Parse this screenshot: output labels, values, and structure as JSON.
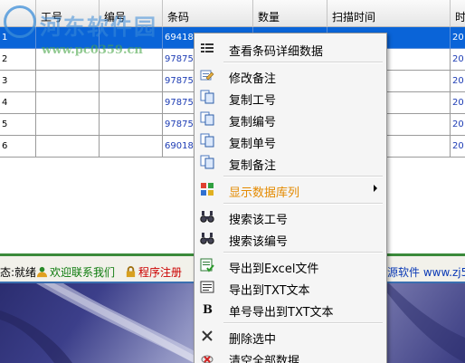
{
  "grid": {
    "columns": [
      "",
      "工号",
      "编号",
      "条码",
      "数量",
      "扫描时间",
      "时"
    ],
    "rows": [
      {
        "index": "1",
        "barcode": "694182",
        "time": "20"
      },
      {
        "index": "2",
        "barcode": "978755",
        "time": "20"
      },
      {
        "index": "3",
        "barcode": "978756",
        "time": "20"
      },
      {
        "index": "4",
        "barcode": "978750",
        "time": "20"
      },
      {
        "index": "5",
        "barcode": "978754",
        "time": "20"
      },
      {
        "index": "6",
        "barcode": "690182",
        "time": "20"
      }
    ],
    "selected_row": 0
  },
  "status": {
    "state": "态:就绪",
    "contact": "欢迎联系我们",
    "register": "程序注册",
    "vendor": "源软件 www.zj5"
  },
  "watermark": {
    "title": "河东软件园",
    "url": "www.pc0359.cn"
  },
  "menu": {
    "items": [
      {
        "label": "查看条码详细数据",
        "icon": "grid-details-icon"
      },
      {
        "label": "修改备注",
        "icon": "edit-note-icon"
      },
      {
        "label": "复制工号",
        "icon": "copy-icon"
      },
      {
        "label": "复制编号",
        "icon": "copy-icon"
      },
      {
        "label": "复制单号",
        "icon": "copy-icon"
      },
      {
        "label": "复制备注",
        "icon": "copy-icon"
      },
      {
        "label": "显示数据库列",
        "icon": "database-columns-icon",
        "submenu": true
      },
      {
        "label": "搜索该工号",
        "icon": "binoculars-icon"
      },
      {
        "label": "搜索该编号",
        "icon": "binoculars-icon"
      },
      {
        "label": "导出到Excel文件",
        "icon": "excel-export-icon"
      },
      {
        "label": "导出到TXT文本",
        "icon": "txt-export-icon"
      },
      {
        "label": "单号导出到TXT文本",
        "icon": "bold-b-icon"
      },
      {
        "label": "删除选中",
        "icon": "delete-x-icon"
      },
      {
        "label": "清空全部数据",
        "icon": "clear-all-icon"
      }
    ]
  },
  "colors": {
    "selection": "#0a64d8",
    "submenu_label": "#e48a00",
    "status_green": "#0b7a0b",
    "status_red": "#cc0000"
  }
}
